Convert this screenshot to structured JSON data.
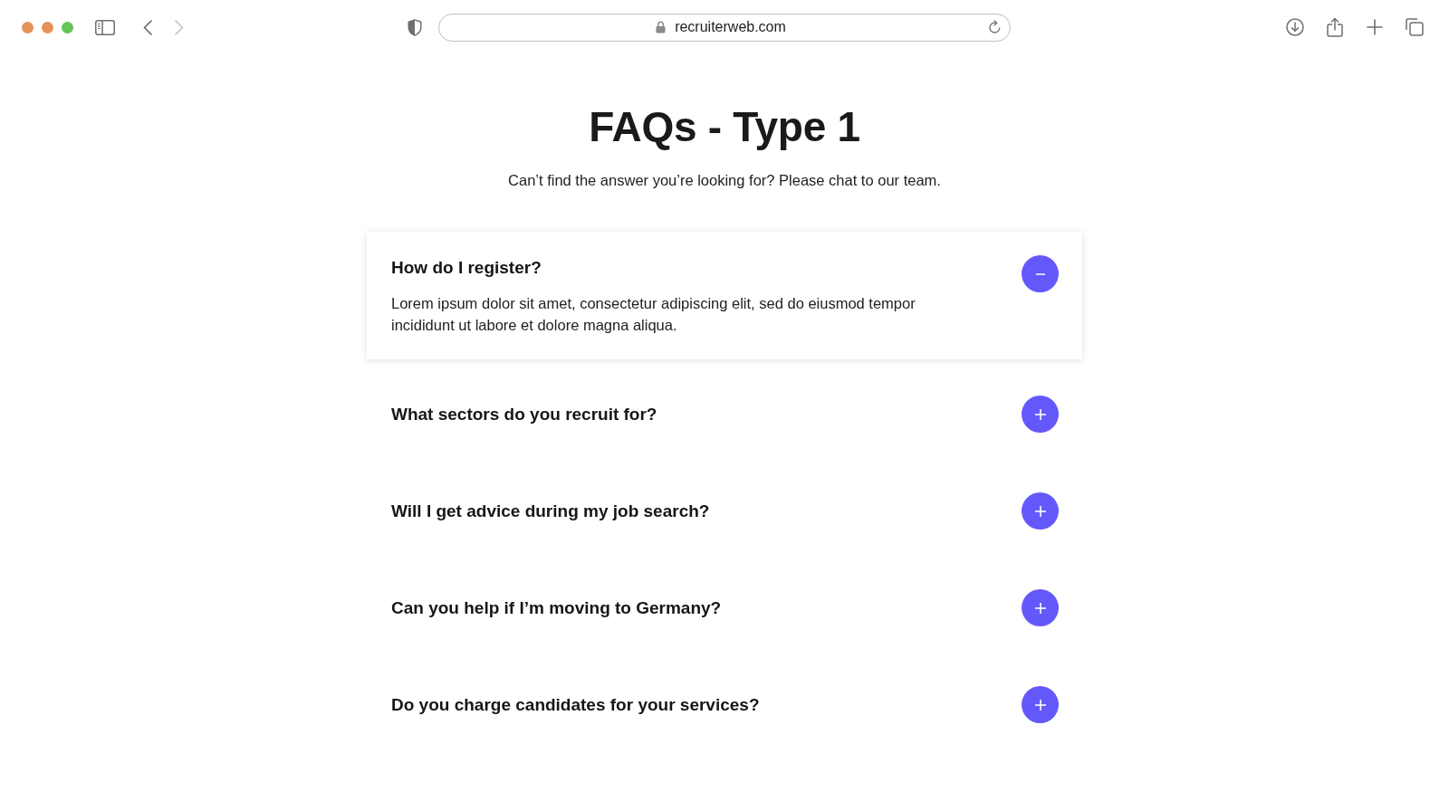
{
  "browser": {
    "back": {
      "disabled": false
    },
    "forward": {
      "disabled": true
    },
    "url": "recruiterweb.com"
  },
  "page": {
    "title": "FAQs - Type 1",
    "subtitle": "Can’t find the answer you’re looking for? Please chat to our team."
  },
  "faqs": [
    {
      "question": "How do I register?",
      "answer": "Lorem ipsum dolor sit amet, consectetur adipiscing elit, sed do eiusmod tempor incididunt ut labore et dolore magna aliqua.",
      "expanded": true
    },
    {
      "question": "What sectors do you recruit for?",
      "expanded": false
    },
    {
      "question": "Will I get advice during my job search?",
      "expanded": false
    },
    {
      "question": "Can you help if I’m moving to Germany?",
      "expanded": false
    },
    {
      "question": "Do you charge candidates for your services?",
      "expanded": false
    }
  ]
}
